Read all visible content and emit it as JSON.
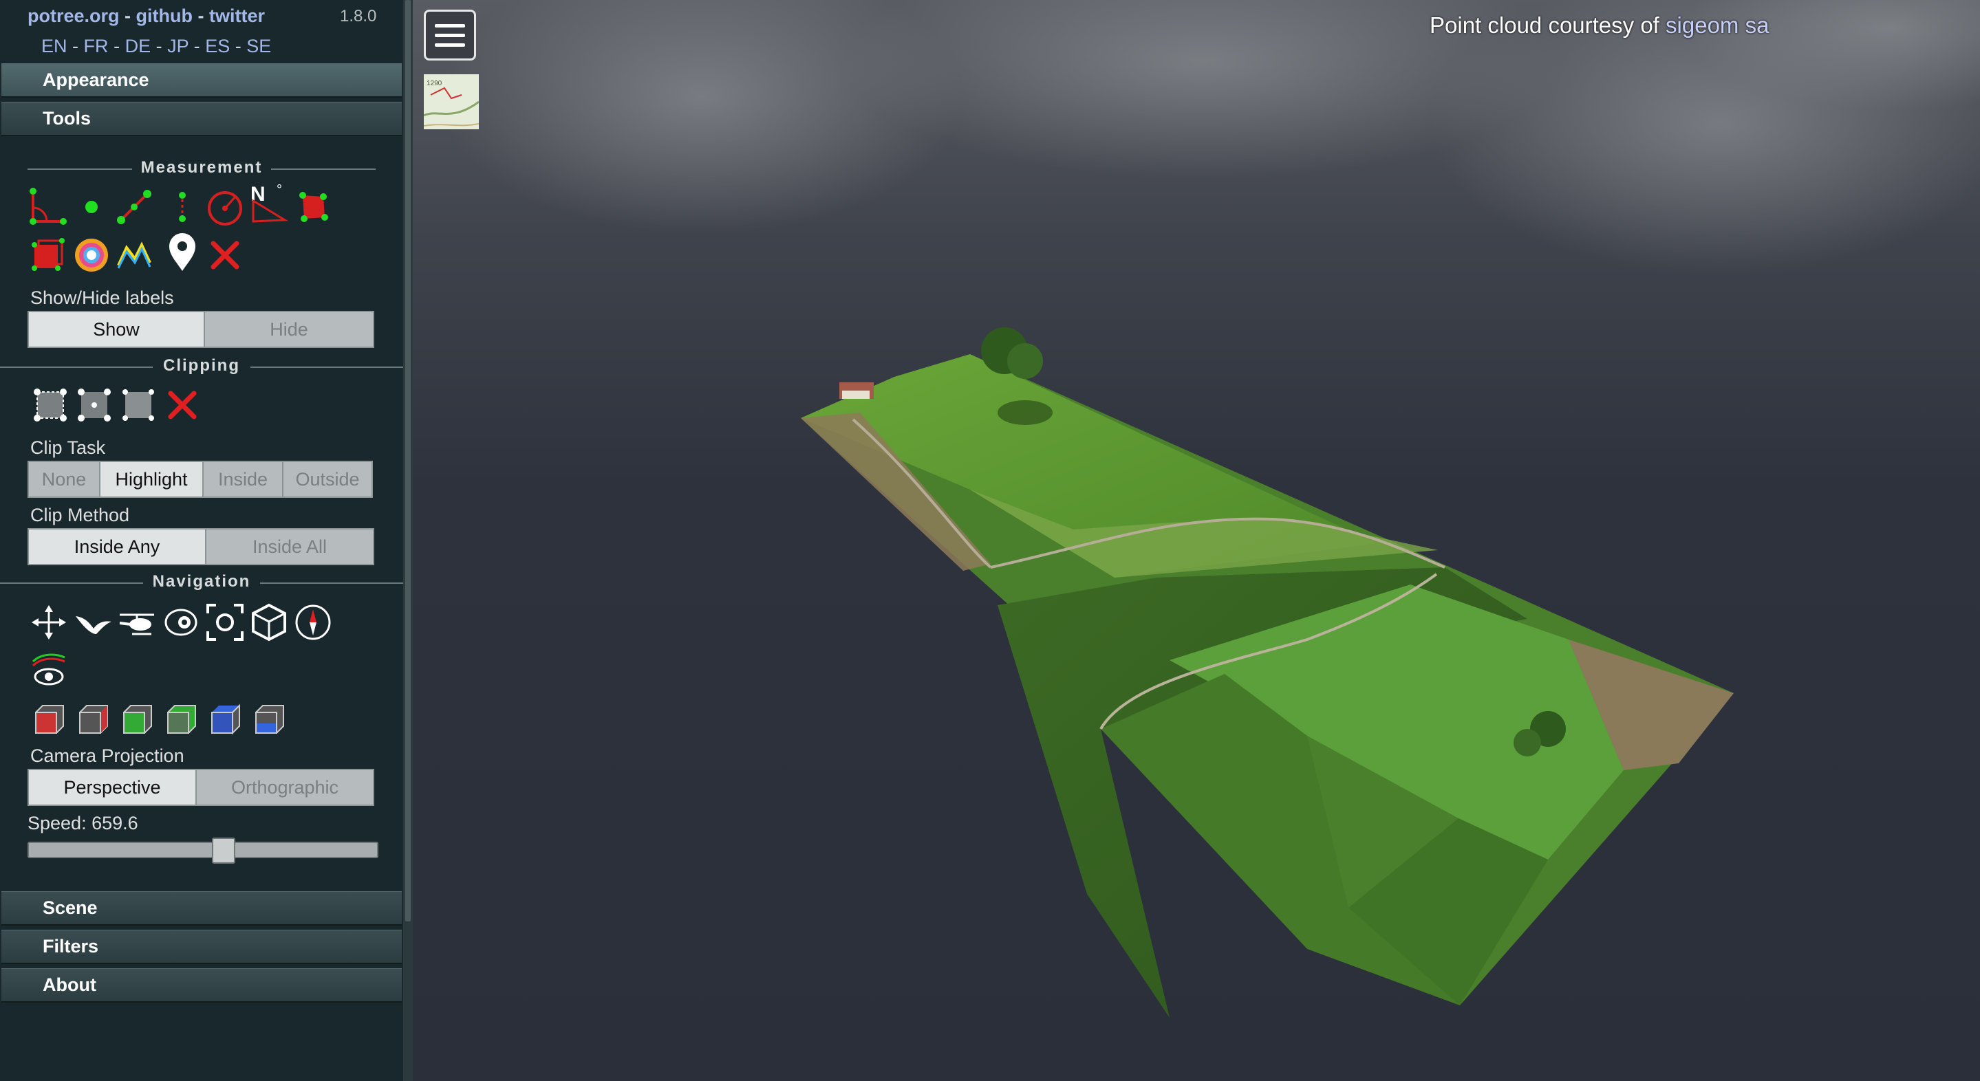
{
  "header": {
    "links": [
      "potree.org",
      "github",
      "twitter"
    ],
    "separator": "-",
    "version": "1.8.0",
    "languages": [
      "EN",
      "FR",
      "DE",
      "JP",
      "ES",
      "SE"
    ]
  },
  "accordion": {
    "appearance": "Appearance",
    "tools": "Tools",
    "scene": "Scene",
    "filters": "Filters",
    "about": "About"
  },
  "measurement": {
    "title": "Measurement",
    "tools": [
      "angle-icon",
      "point-icon",
      "distance-icon",
      "height-icon",
      "circle-icon",
      "azimuth-icon",
      "area-icon",
      "volume-icon",
      "sphere-volume-icon",
      "profile-icon",
      "annotation-icon",
      "remove-measurements-icon"
    ],
    "labels_caption": "Show/Hide labels",
    "labels_options": [
      "Show",
      "Hide"
    ],
    "labels_selected": "Show"
  },
  "clipping": {
    "title": "Clipping",
    "tools": [
      "clip-volume-icon",
      "clip-polygon-icon",
      "clip-screen-box-icon",
      "remove-clipping-icon"
    ],
    "task_caption": "Clip Task",
    "task_options": [
      "None",
      "Highlight",
      "Inside",
      "Outside"
    ],
    "task_selected": "Highlight",
    "method_caption": "Clip Method",
    "method_options": [
      "Inside Any",
      "Inside All"
    ],
    "method_selected": "Inside Any"
  },
  "navigation": {
    "title": "Navigation",
    "tools": [
      "earth-controls-icon",
      "fps-controls-icon",
      "helicopter-controls-icon",
      "orbit-controls-icon",
      "focus-icon",
      "navigation-cube-icon",
      "compass-icon",
      "camera-animation-icon"
    ],
    "views": [
      "left-view-icon",
      "right-view-icon",
      "front-view-icon",
      "back-view-icon",
      "top-view-icon",
      "bottom-view-icon"
    ],
    "projection_caption": "Camera Projection",
    "projection_options": [
      "Perspective",
      "Orthographic"
    ],
    "projection_selected": "Perspective",
    "speed_label": "Speed: 659.6",
    "speed_fraction": 0.56
  },
  "viewport": {
    "credit_prefix": "Point cloud courtesy of",
    "credit_link": "sigeom sa",
    "menu_icon": "hamburger-menu-icon",
    "minimap_icon": "map-thumbnail-icon"
  },
  "colors": {
    "sidebar_bg": "#19282c",
    "link": "#a3b8e8",
    "viewport_bg": "#2a2e3a",
    "terrain_green": "#4f8a2c"
  }
}
